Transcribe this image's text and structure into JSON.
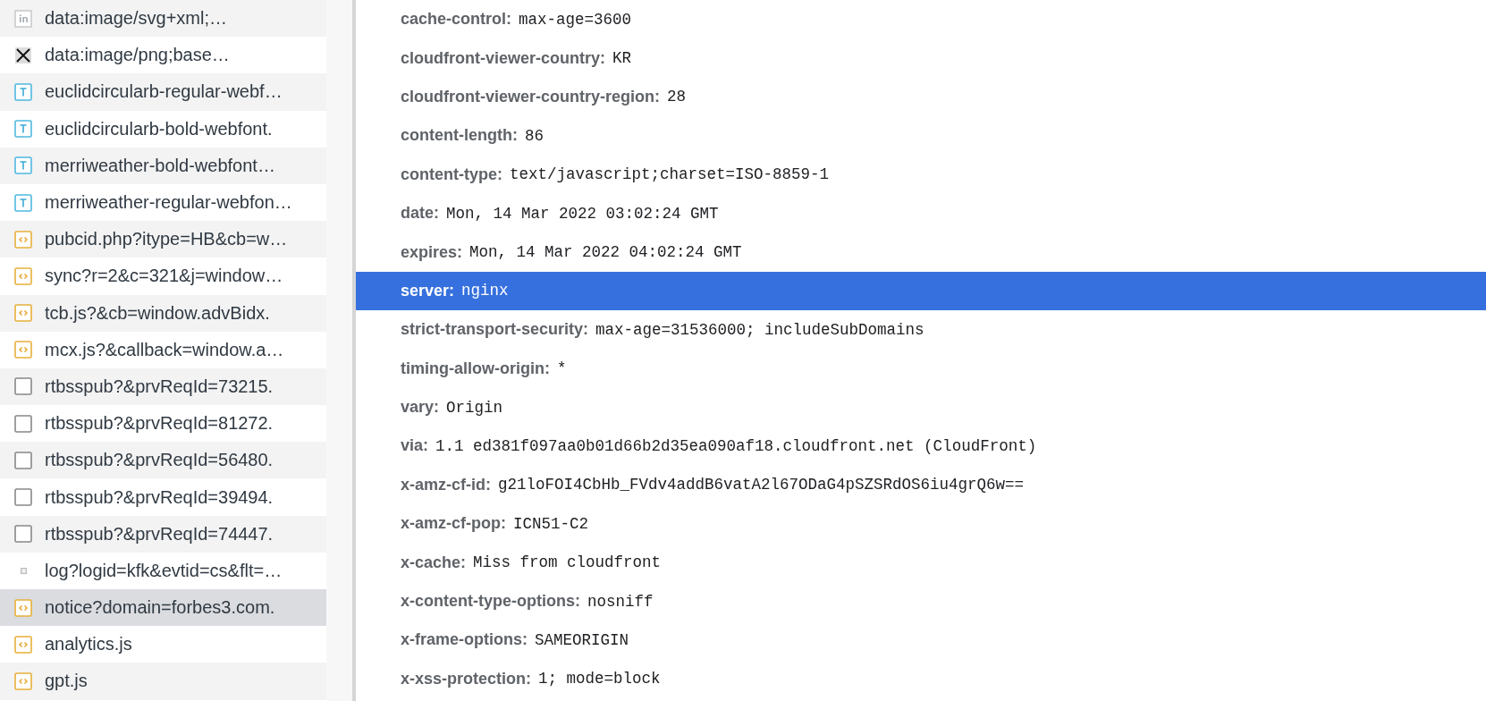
{
  "requests": [
    {
      "kind": "image",
      "name": "data:image/svg+xml;…",
      "selected": false
    },
    {
      "kind": "broken-image",
      "name": "data:image/png;base…",
      "selected": false
    },
    {
      "kind": "font",
      "name": "euclidcircularb-regular-webf…",
      "selected": false
    },
    {
      "kind": "font",
      "name": "euclidcircularb-bold-webfont.",
      "selected": false
    },
    {
      "kind": "font",
      "name": "merriweather-bold-webfont…",
      "selected": false
    },
    {
      "kind": "font",
      "name": "merriweather-regular-webfon…",
      "selected": false
    },
    {
      "kind": "script",
      "name": "pubcid.php?itype=HB&cb=w…",
      "selected": false
    },
    {
      "kind": "script",
      "name": "sync?r=2&c=321&j=window…",
      "selected": false
    },
    {
      "kind": "script",
      "name": "tcb.js?&cb=window.advBidx.",
      "selected": false
    },
    {
      "kind": "script",
      "name": "mcx.js?&callback=window.a…",
      "selected": false
    },
    {
      "kind": "document",
      "name": "rtbsspub?&prvReqId=73215.",
      "selected": false
    },
    {
      "kind": "document",
      "name": "rtbsspub?&prvReqId=81272.",
      "selected": false
    },
    {
      "kind": "document",
      "name": "rtbsspub?&prvReqId=56480.",
      "selected": false
    },
    {
      "kind": "document",
      "name": "rtbsspub?&prvReqId=39494.",
      "selected": false
    },
    {
      "kind": "document",
      "name": "rtbsspub?&prvReqId=74447.",
      "selected": false
    },
    {
      "kind": "ping",
      "name": "log?logid=kfk&evtid=cs&flt=…",
      "selected": false
    },
    {
      "kind": "script",
      "name": "notice?domain=forbes3.com.",
      "selected": true
    },
    {
      "kind": "script",
      "name": "analytics.js",
      "selected": false
    },
    {
      "kind": "script",
      "name": "gpt.js",
      "selected": false
    }
  ],
  "response_headers": [
    {
      "name": "cache-control:",
      "value": "max-age=3600",
      "selected": false
    },
    {
      "name": "cloudfront-viewer-country:",
      "value": "KR",
      "selected": false
    },
    {
      "name": "cloudfront-viewer-country-region:",
      "value": "28",
      "selected": false
    },
    {
      "name": "content-length:",
      "value": "86",
      "selected": false
    },
    {
      "name": "content-type:",
      "value": "text/javascript;charset=ISO-8859-1",
      "selected": false
    },
    {
      "name": "date:",
      "value": "Mon, 14 Mar 2022 03:02:24 GMT",
      "selected": false
    },
    {
      "name": "expires:",
      "value": "Mon, 14 Mar 2022 04:02:24 GMT",
      "selected": false
    },
    {
      "name": "server:",
      "value": "nginx",
      "selected": true
    },
    {
      "name": "strict-transport-security:",
      "value": "max-age=31536000; includeSubDomains",
      "selected": false
    },
    {
      "name": "timing-allow-origin:",
      "value": "*",
      "selected": false
    },
    {
      "name": "vary:",
      "value": "Origin",
      "selected": false
    },
    {
      "name": "via:",
      "value": "1.1 ed381f097aa0b01d66b2d35ea090af18.cloudfront.net (CloudFront)",
      "selected": false
    },
    {
      "name": "x-amz-cf-id:",
      "value": "g21loFOI4CbHb_FVdv4addB6vatA2l67ODaG4pSZSRdOS6iu4grQ6w==",
      "selected": false
    },
    {
      "name": "x-amz-cf-pop:",
      "value": "ICN51-C2",
      "selected": false
    },
    {
      "name": "x-cache:",
      "value": "Miss from cloudfront",
      "selected": false
    },
    {
      "name": "x-content-type-options:",
      "value": "nosniff",
      "selected": false
    },
    {
      "name": "x-frame-options:",
      "value": "SAMEORIGIN",
      "selected": false
    },
    {
      "name": "x-xss-protection:",
      "value": "1; mode=block",
      "selected": false
    }
  ]
}
